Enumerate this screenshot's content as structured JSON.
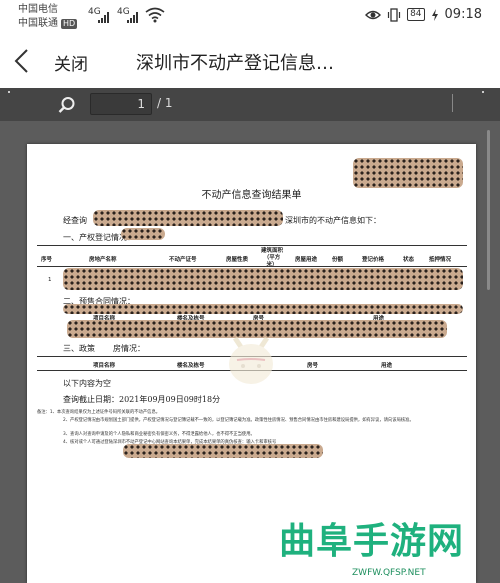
{
  "status_bar": {
    "carrier_1": "中国电信",
    "carrier_2": "中国联通",
    "hd_badge": "HD",
    "net_1": "4G",
    "net_2": "4G",
    "battery": "84",
    "time": "09:18"
  },
  "header": {
    "close_label": "关闭",
    "title": "深圳市不动产登记信息…"
  },
  "viewer": {
    "page_current": "1",
    "page_total": "/ 1"
  },
  "document": {
    "title": "不动产信息查询结果单",
    "intro_prefix": "经查询",
    "intro_suffix": "深圳市的不动产信息如下：",
    "section1": "一、产权登记情况：",
    "table1_headers": [
      "序号",
      "房地产名称",
      "不动产证号",
      "房屋性质",
      "建筑面积（平方米）",
      "房屋用途",
      "份额",
      "登记价格",
      "状态",
      "抵押情况"
    ],
    "row1_index": "1",
    "section2": "二、预售合同情况：",
    "table2_headers": [
      "项目名称",
      "楼名及栋号",
      "房号",
      "用途"
    ],
    "section3_prefix": "三、政策",
    "section3_suffix": "房情况：",
    "table3_headers": [
      "项目名称",
      "楼名及栋号",
      "房号",
      "用途"
    ],
    "empty_text": "以下内容为空",
    "deadline": "查询截止日期：2021年09月09日09时18分",
    "notes": [
      "备注：1、本次查询结果仅为上述证件号码所关联的不动产信息。",
      "2、产权登记情况由市规划国土部门提供，产权登记情况与登记簿记载不一致的，以登记簿记载为准。政策性住房情况、预售合同情况由市住房和建设局提供，如有异议，请向该局核准。",
      "3、查询人对查询申请及的个人隐私和商业秘密负有保密义务，不得泄露给他人，也不得不正当使用。",
      "4、核对或个人可通过登陆深圳市不动产登记中心网站查询本结果单，完成本结果单的真伪核查：输入卡和审核号"
    ]
  },
  "watermark": {
    "text": "曲阜手游网",
    "url": "ZWFW.QFSP.NET"
  }
}
